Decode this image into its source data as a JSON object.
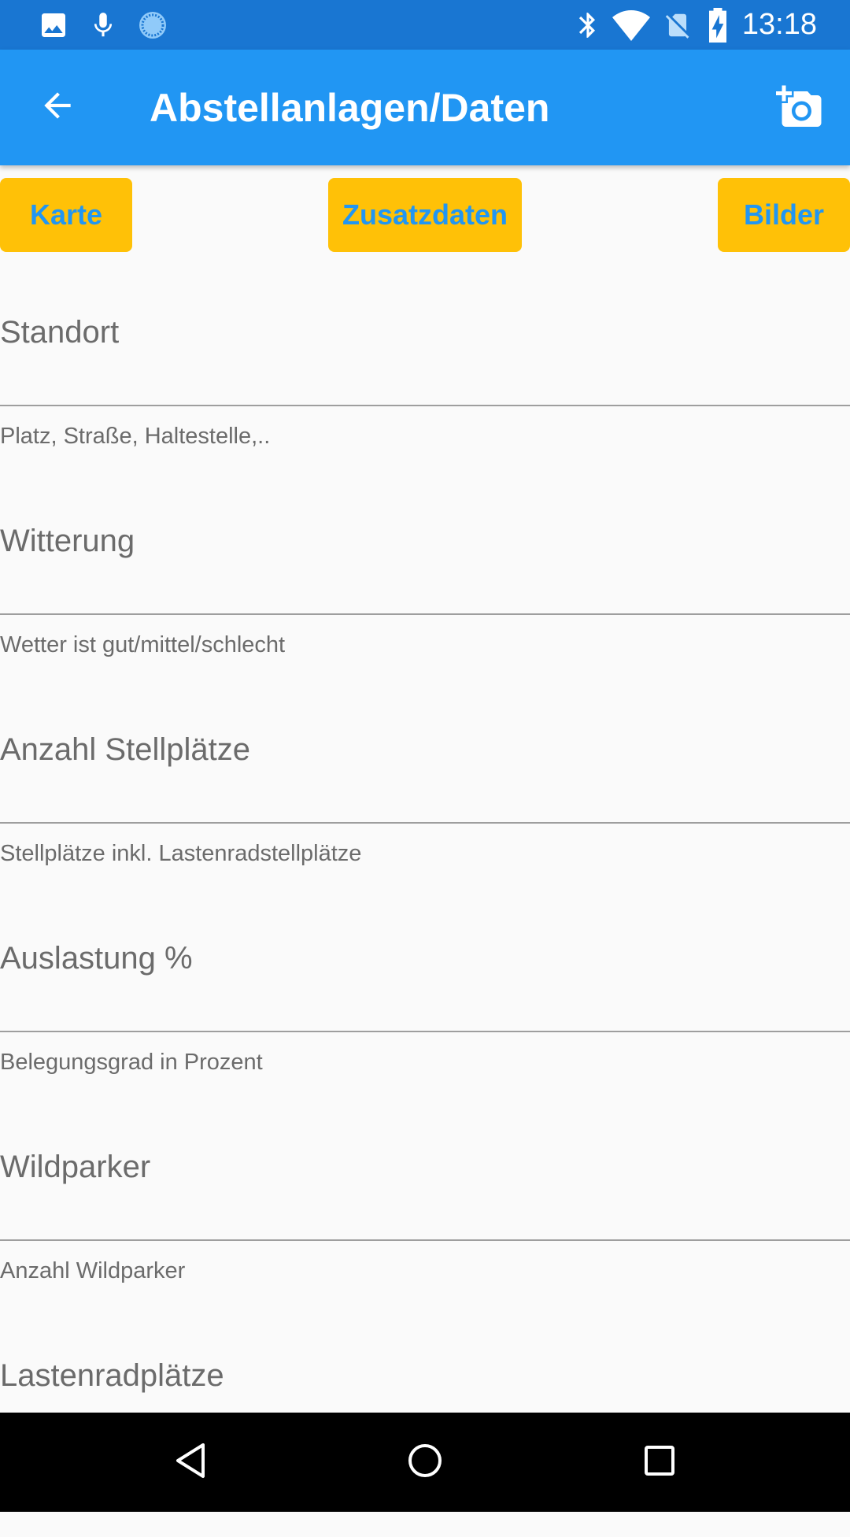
{
  "status_bar": {
    "time": "13:18",
    "left_icons": [
      "image-icon",
      "mic-icon",
      "sync-icon"
    ],
    "right_icons": [
      "bluetooth-icon",
      "wifi-icon",
      "no-sim-icon",
      "battery-charging-icon"
    ]
  },
  "app_bar": {
    "title": "Abstellanlagen/Daten",
    "back_icon": "arrow-back-icon",
    "action_icon": "add-a-photo-icon",
    "background": "#2196f3"
  },
  "actions": {
    "karte": "Karte",
    "zusatzdaten": "Zusatzdaten",
    "bilder": "Bilder",
    "button_color": "#ffc107",
    "text_color": "#2196f3"
  },
  "fields": [
    {
      "label": "Standort",
      "helper": "Platz, Straße, Haltestelle,..",
      "value": ""
    },
    {
      "label": "Witterung",
      "helper": "Wetter ist gut/mittel/schlecht",
      "value": ""
    },
    {
      "label": "Anzahl Stellplätze",
      "helper": "Stellplätze inkl. Lastenradstellplätze",
      "value": ""
    },
    {
      "label": "Auslastung %",
      "helper": "Belegungsgrad in Prozent",
      "value": ""
    },
    {
      "label": "Wildparker",
      "helper": "Anzahl Wildparker",
      "value": ""
    },
    {
      "label": "Lastenradplätze",
      "helper": "",
      "value": ""
    }
  ],
  "nav_bar": {
    "back": "nav-back-icon",
    "home": "nav-home-icon",
    "recents": "nav-recents-icon"
  }
}
